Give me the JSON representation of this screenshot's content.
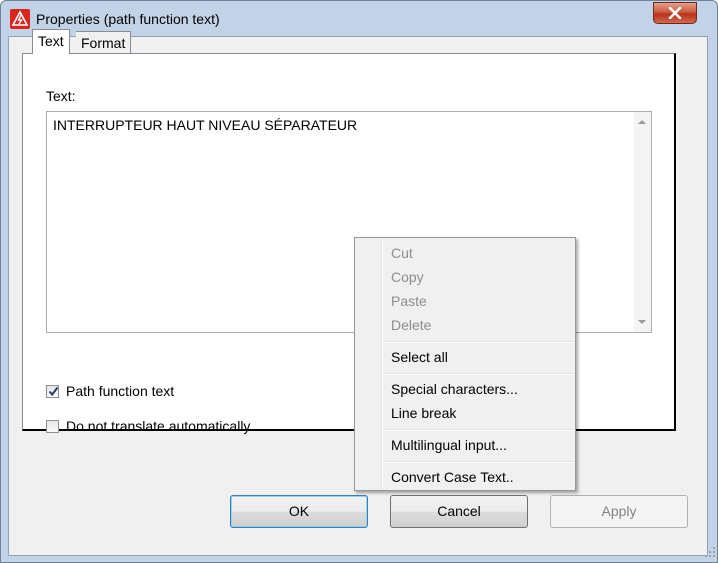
{
  "window": {
    "title": "Properties (path function text)"
  },
  "tabs": [
    {
      "label": "Text",
      "active": true
    },
    {
      "label": "Format",
      "active": false
    }
  ],
  "text_section": {
    "label": "Text:",
    "value": "INTERRUPTEUR HAUT NIVEAU SÉPARATEUR"
  },
  "options": {
    "path_function_text": {
      "label": "Path function text",
      "checked": true
    },
    "do_not_translate": {
      "label": "Do not translate automatically",
      "checked": false
    }
  },
  "buttons": {
    "ok": "OK",
    "cancel": "Cancel",
    "apply": "Apply"
  },
  "context_menu": {
    "items": [
      {
        "label": "Cut",
        "enabled": false
      },
      {
        "label": "Copy",
        "enabled": false
      },
      {
        "label": "Paste",
        "enabled": false
      },
      {
        "label": "Delete",
        "enabled": false
      },
      {
        "label": "Select all",
        "enabled": true
      },
      {
        "label": "Special characters...",
        "enabled": true
      },
      {
        "label": "Line break",
        "enabled": true
      },
      {
        "label": "Multilingual input...",
        "enabled": true
      },
      {
        "label": "Convert Case Text..",
        "enabled": true
      }
    ]
  },
  "colors": {
    "accent": "#3c7fb1",
    "close": "#c7452a",
    "disabled_text": "#8d8d8d"
  }
}
